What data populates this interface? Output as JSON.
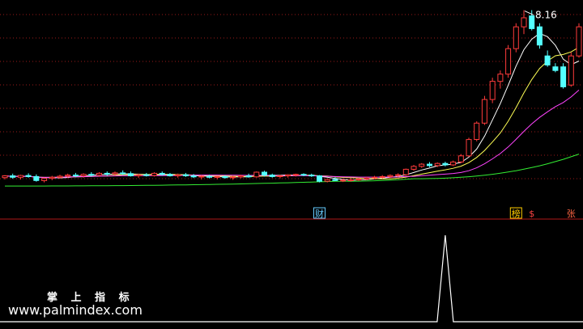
{
  "chart_data": {
    "type": "candlestick",
    "peak_label": "8.16",
    "colors": {
      "background": "#000000",
      "grid": "#9a1a1a",
      "up": "#ff3b3b",
      "down": "#54ffff",
      "ma5": "#ffffff",
      "ma10": "#ffff55",
      "ma20": "#ff44ff",
      "ma60": "#33ee33",
      "signal": "#ffffff",
      "divider": "#b01818"
    },
    "candles": [
      [
        3.55,
        3.62,
        3.5,
        3.6
      ],
      [
        3.6,
        3.66,
        3.52,
        3.56
      ],
      [
        3.56,
        3.63,
        3.5,
        3.61
      ],
      [
        3.61,
        3.67,
        3.55,
        3.58
      ],
      [
        3.58,
        3.64,
        3.44,
        3.47
      ],
      [
        3.47,
        3.55,
        3.42,
        3.53
      ],
      [
        3.53,
        3.6,
        3.48,
        3.56
      ],
      [
        3.56,
        3.63,
        3.52,
        3.59
      ],
      [
        3.59,
        3.66,
        3.55,
        3.62
      ],
      [
        3.62,
        3.68,
        3.56,
        3.6
      ],
      [
        3.6,
        3.67,
        3.55,
        3.64
      ],
      [
        3.64,
        3.7,
        3.58,
        3.62
      ],
      [
        3.62,
        3.7,
        3.58,
        3.67
      ],
      [
        3.67,
        3.72,
        3.6,
        3.65
      ],
      [
        3.65,
        3.72,
        3.6,
        3.68
      ],
      [
        3.68,
        3.75,
        3.62,
        3.66
      ],
      [
        3.66,
        3.72,
        3.58,
        3.6
      ],
      [
        3.6,
        3.66,
        3.54,
        3.63
      ],
      [
        3.63,
        3.68,
        3.58,
        3.61
      ],
      [
        3.61,
        3.7,
        3.58,
        3.67
      ],
      [
        3.67,
        3.72,
        3.6,
        3.64
      ],
      [
        3.64,
        3.68,
        3.58,
        3.6
      ],
      [
        3.6,
        3.66,
        3.55,
        3.63
      ],
      [
        3.63,
        3.68,
        3.57,
        3.6
      ],
      [
        3.6,
        3.65,
        3.54,
        3.57
      ],
      [
        3.57,
        3.62,
        3.5,
        3.59
      ],
      [
        3.59,
        3.63,
        3.53,
        3.56
      ],
      [
        3.56,
        3.6,
        3.5,
        3.58
      ],
      [
        3.58,
        3.62,
        3.52,
        3.55
      ],
      [
        3.55,
        3.6,
        3.49,
        3.57
      ],
      [
        3.57,
        3.63,
        3.53,
        3.6
      ],
      [
        3.6,
        3.66,
        3.55,
        3.57
      ],
      [
        3.57,
        3.72,
        3.55,
        3.7
      ],
      [
        3.7,
        3.74,
        3.58,
        3.62
      ],
      [
        3.62,
        3.66,
        3.55,
        3.58
      ],
      [
        3.58,
        3.63,
        3.53,
        3.6
      ],
      [
        3.6,
        3.64,
        3.55,
        3.63
      ],
      [
        3.63,
        3.66,
        3.58,
        3.64
      ],
      [
        3.64,
        3.67,
        3.59,
        3.62
      ],
      [
        3.62,
        3.66,
        3.57,
        3.6
      ],
      [
        3.6,
        3.62,
        3.42,
        3.45
      ],
      [
        3.45,
        3.52,
        3.42,
        3.5
      ],
      [
        3.5,
        3.56,
        3.46,
        3.47
      ],
      [
        3.47,
        3.52,
        3.43,
        3.48
      ],
      [
        3.48,
        3.53,
        3.44,
        3.49
      ],
      [
        3.49,
        3.55,
        3.46,
        3.51
      ],
      [
        3.51,
        3.57,
        3.48,
        3.54
      ],
      [
        3.54,
        3.6,
        3.5,
        3.56
      ],
      [
        3.56,
        3.62,
        3.52,
        3.58
      ],
      [
        3.58,
        3.64,
        3.54,
        3.61
      ],
      [
        3.61,
        3.67,
        3.57,
        3.63
      ],
      [
        3.63,
        3.8,
        3.6,
        3.78
      ],
      [
        3.78,
        3.9,
        3.74,
        3.86
      ],
      [
        3.86,
        3.95,
        3.82,
        3.92
      ],
      [
        3.92,
        3.98,
        3.84,
        3.88
      ],
      [
        3.88,
        3.97,
        3.84,
        3.94
      ],
      [
        3.94,
        3.99,
        3.86,
        3.9
      ],
      [
        3.9,
        4.02,
        3.87,
        3.98
      ],
      [
        3.98,
        4.2,
        3.95,
        4.15
      ],
      [
        4.15,
        4.65,
        4.12,
        4.6
      ],
      [
        4.6,
        5.1,
        4.55,
        5.05
      ],
      [
        5.05,
        5.8,
        5.0,
        5.7
      ],
      [
        5.7,
        6.3,
        5.6,
        6.2
      ],
      [
        6.2,
        6.5,
        6.0,
        6.4
      ],
      [
        6.4,
        7.2,
        6.3,
        7.1
      ],
      [
        7.1,
        7.8,
        7.0,
        7.7
      ],
      [
        7.7,
        8.16,
        7.5,
        7.95
      ],
      [
        8.0,
        8.16,
        7.6,
        7.65
      ],
      [
        7.7,
        7.8,
        7.1,
        7.2
      ],
      [
        6.9,
        7.05,
        6.6,
        6.65
      ],
      [
        6.6,
        6.7,
        6.45,
        6.5
      ],
      [
        6.6,
        6.7,
        6.0,
        6.05
      ],
      [
        6.1,
        7.0,
        6.05,
        6.9
      ],
      [
        6.9,
        7.8,
        6.85,
        7.7
      ]
    ],
    "ma": [
      {
        "period": 5,
        "color": "#ffffff"
      },
      {
        "period": 10,
        "color": "#ffff55"
      },
      {
        "period": 20,
        "color": "#ff44ff"
      },
      {
        "period": 60,
        "color": "#33ee33"
      }
    ],
    "ma60_anchor": [
      [
        0,
        3.32
      ],
      [
        42,
        3.45
      ],
      [
        52,
        3.52
      ],
      [
        73,
        4.2
      ]
    ],
    "markers": [
      {
        "index": 40,
        "text": "财",
        "color": "#66ccff",
        "box": true
      },
      {
        "index": 65,
        "text": "榜",
        "color": "#ffcc00",
        "box": true
      },
      {
        "index": 67,
        "text": "$",
        "color": "#ff4444",
        "box": false
      },
      {
        "index": 72,
        "text": "张",
        "color": "#ff6644",
        "box": false
      }
    ],
    "signal": {
      "index": 56,
      "value": 1
    },
    "ylim": [
      3.1,
      8.35
    ]
  },
  "watermark": {
    "title": "掌 上 指 标",
    "url": "www.palmindex.com"
  }
}
